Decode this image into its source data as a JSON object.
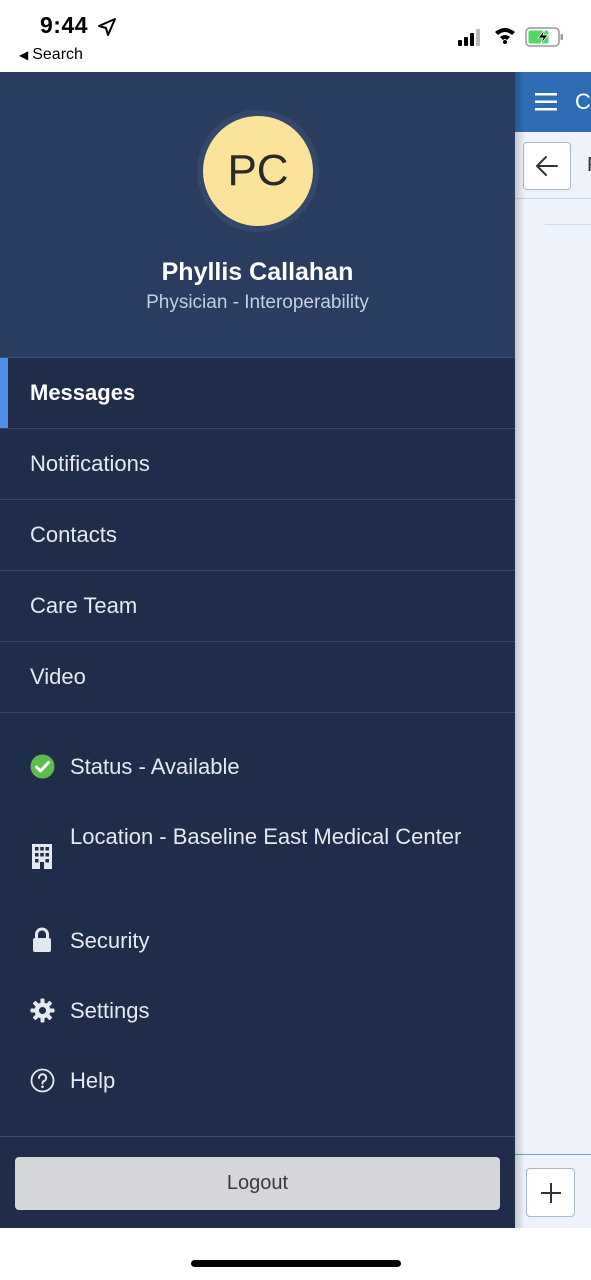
{
  "status_bar": {
    "time": "9:44",
    "back_label": "Search",
    "back_glyph": "◀"
  },
  "profile": {
    "initials": "PC",
    "name": "Phyllis Callahan",
    "role": "Physician - Interoperability",
    "avatar_color": "#fbe39a"
  },
  "nav": {
    "items": [
      {
        "label": "Messages",
        "active": true
      },
      {
        "label": "Notifications",
        "active": false
      },
      {
        "label": "Contacts",
        "active": false
      },
      {
        "label": "Care Team",
        "active": false
      },
      {
        "label": "Video",
        "active": false
      }
    ],
    "accent_color": "#4f8ee6"
  },
  "secondary": {
    "status": {
      "label": "Status - Available",
      "icon": "check-circle-icon",
      "color": "#5bbd4a"
    },
    "location": {
      "label": "Location - Baseline East Medical Center",
      "icon": "building-icon"
    },
    "security": {
      "label": "Security",
      "icon": "lock-icon"
    },
    "settings": {
      "label": "Settings",
      "icon": "gear-icon"
    },
    "help": {
      "label": "Help",
      "icon": "question-circle-icon"
    }
  },
  "logout_label": "Logout",
  "main_peek": {
    "title_peek": "C",
    "letter_peek": "F",
    "header_color": "#2e6db3"
  },
  "colors": {
    "drawer_bg": "#1f2d4a",
    "profile_bg": "#2a3d61"
  }
}
